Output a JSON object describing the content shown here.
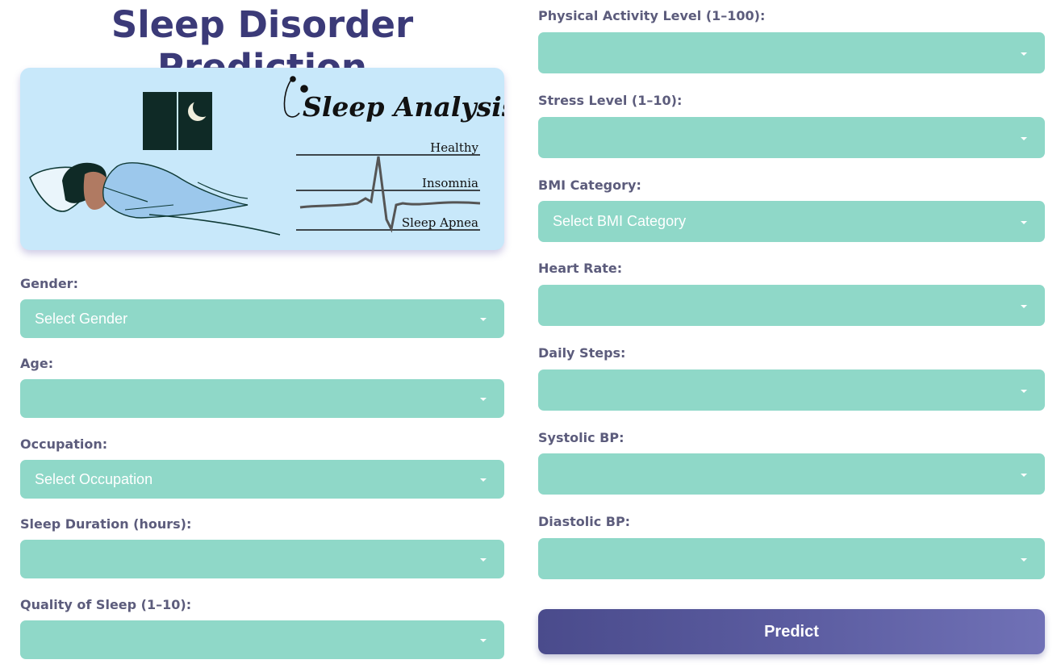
{
  "page": {
    "title": "Sleep Disorder Prediction"
  },
  "banner": {
    "heading": "Sleep Analysis",
    "lines": [
      "Healthy",
      "Insomnia",
      "Sleep Apnea"
    ]
  },
  "form": {
    "left": [
      {
        "label": "Gender:",
        "value": "Select Gender"
      },
      {
        "label": "Age:",
        "value": ""
      },
      {
        "label": "Occupation:",
        "value": "Select Occupation"
      },
      {
        "label": "Sleep Duration (hours):",
        "value": ""
      },
      {
        "label": "Quality of Sleep (1–10):",
        "value": ""
      }
    ],
    "right": [
      {
        "label": "Physical Activity Level (1–100):",
        "value": ""
      },
      {
        "label": "Stress Level (1–10):",
        "value": ""
      },
      {
        "label": "BMI Category:",
        "value": "Select BMI Category"
      },
      {
        "label": "Heart Rate:",
        "value": ""
      },
      {
        "label": "Daily Steps:",
        "value": ""
      },
      {
        "label": "Systolic BP:",
        "value": ""
      },
      {
        "label": "Diastolic BP:",
        "value": ""
      }
    ],
    "submit_label": "Predict"
  },
  "colors": {
    "title": "#3b3a78",
    "field_bg": "#8fd8c8",
    "banner_bg": "#c8e8fa",
    "button_start": "#4a4b8c",
    "button_end": "#7071b6"
  }
}
